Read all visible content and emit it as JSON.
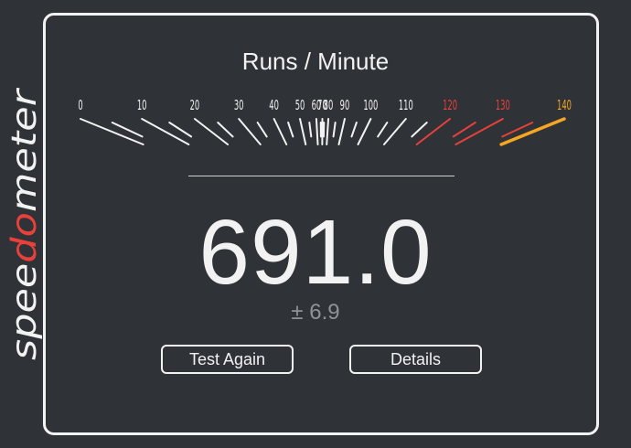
{
  "logo": {
    "text_before": "spee",
    "text_accent": "do",
    "text_after": "meter",
    "color_main": "#f2f2f2",
    "color_accent": "#e8413c"
  },
  "title": "Runs / Minute",
  "gauge": {
    "labels": [
      "0",
      "10",
      "20",
      "30",
      "40",
      "50",
      "60",
      "70",
      "80",
      "90",
      "100",
      "110",
      "120",
      "130",
      "140"
    ],
    "normal_color": "#f2f2f2",
    "warn_color": "#e8413c",
    "max_color": "#f5a623",
    "warn_from": 120
  },
  "result": {
    "score": "691.0",
    "error": "± 6.9"
  },
  "buttons": {
    "test_again": "Test Again",
    "details": "Details"
  }
}
